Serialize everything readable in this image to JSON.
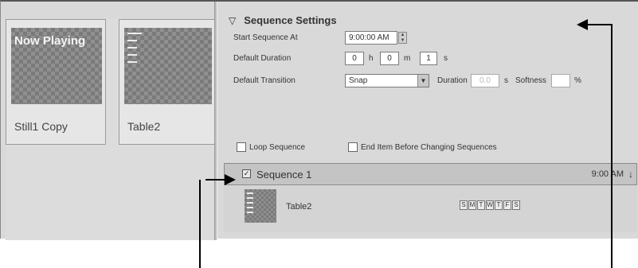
{
  "media": {
    "items": [
      {
        "thumb_title": "Now Playing",
        "label": "Still1 Copy"
      },
      {
        "label": "Table2"
      }
    ]
  },
  "settings": {
    "title": "Sequence Settings",
    "start_label": "Start Sequence At",
    "start_value": "9:00:00 AM",
    "duration_label": "Default Duration",
    "duration_h": "0",
    "duration_h_unit": "h",
    "duration_m": "0",
    "duration_m_unit": "m",
    "duration_s": "1",
    "duration_s_unit": "s",
    "transition_label": "Default Transition",
    "transition_value": "Snap",
    "trans_duration_label": "Duration",
    "trans_duration_value": "0.0",
    "trans_duration_unit": "s",
    "softness_label": "Softness",
    "softness_value": "",
    "softness_unit": "%",
    "loop_label": "Loop Sequence",
    "end_item_label": "End Item Before Changing Sequences"
  },
  "sequence": {
    "checked": "✓",
    "title": "Sequence 1",
    "time": "9:00 AM",
    "arrow": "↓",
    "item_label": "Table2",
    "days": [
      "S",
      "M",
      "T",
      "W",
      "T",
      "F",
      "S"
    ]
  }
}
